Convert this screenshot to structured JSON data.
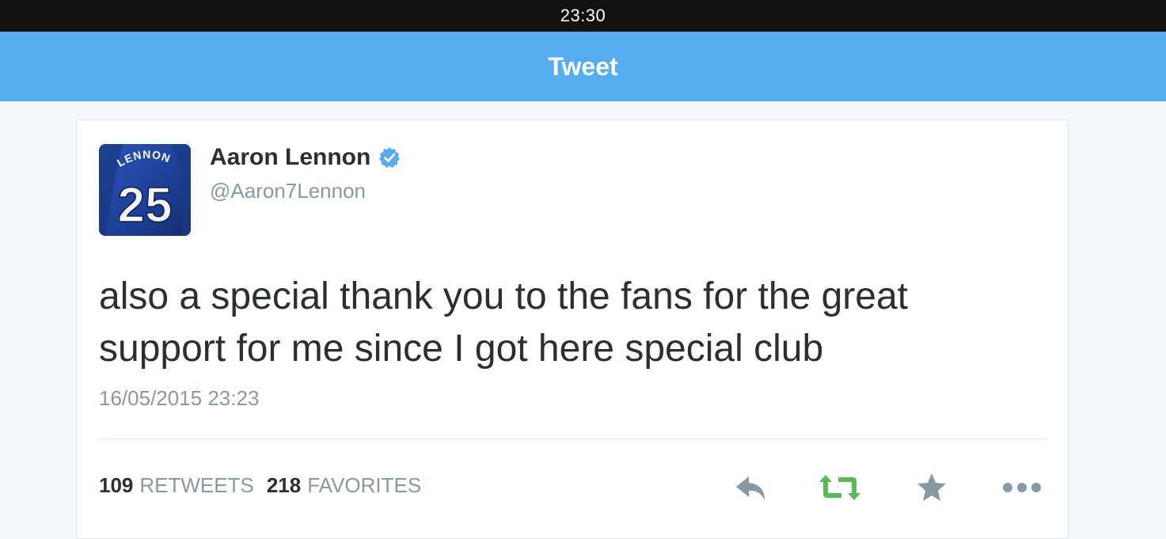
{
  "status_bar": {
    "time": "23:30"
  },
  "nav": {
    "title": "Tweet"
  },
  "colors": {
    "brand": "#55acee",
    "retweet": "#5cb85c",
    "icon_gray": "#8899a6",
    "verified": "#55acee"
  },
  "tweet": {
    "author": {
      "name": "Aaron Lennon",
      "handle": "@Aaron7Lennon",
      "verified": true,
      "avatar": {
        "shirt_name": "LENNON",
        "shirt_number": "25"
      }
    },
    "text_line1": "also a special thank you to the fans for the great",
    "text_line2": "support for me since I got here special club",
    "timestamp": "16/05/2015 23:23",
    "retweets_count": "109",
    "retweets_label": "RETWEETS",
    "favorites_count": "218",
    "favorites_label": "FAVORITES"
  },
  "actions": [
    {
      "name": "reply",
      "icon": "reply-icon"
    },
    {
      "name": "retweet",
      "icon": "retweet-icon"
    },
    {
      "name": "favorite",
      "icon": "star-icon"
    },
    {
      "name": "more",
      "icon": "more-icon"
    }
  ]
}
